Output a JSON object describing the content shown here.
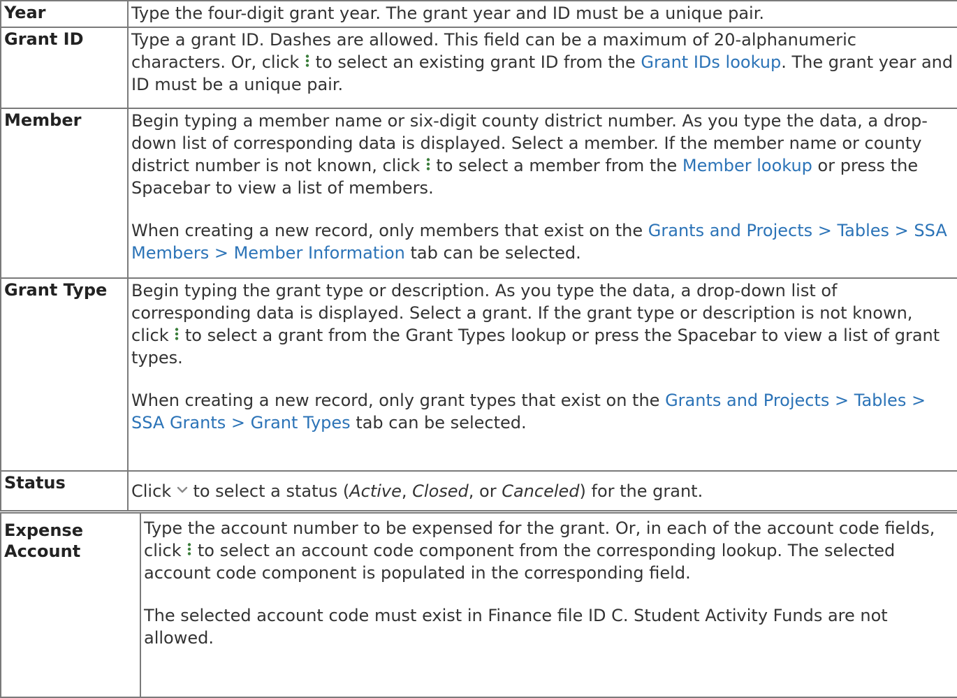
{
  "rows": {
    "year": {
      "label": "Year",
      "text": "Type the four-digit grant year. The grant year and ID must be a unique pair."
    },
    "grant_id": {
      "label": "Grant ID",
      "t1": "Type a grant ID. Dashes are allowed. This field can be a maximum of 20-alphanumeric characters. Or, click ",
      "t2": " to select an existing grant ID from the ",
      "link": "Grant IDs lookup",
      "t3": ". The grant year and ID must be a unique pair."
    },
    "member": {
      "label": "Member",
      "t1": "Begin typing a member name or six-digit county district number. As you type the data, a drop-down list of corresponding data is displayed. Select a member. If the member name or county district number is not known, click ",
      "t2": " to select a member from the ",
      "link": "Member lookup",
      "t3": " or press the Spacebar to view a list of members.",
      "p2_t1": "When creating a new record, only members that exist on the ",
      "p2_link": "Grants and Projects > Tables > SSA Members > Member Information",
      "p2_t2": " tab can be selected."
    },
    "grant_type": {
      "label": "Grant Type",
      "t1": "Begin typing the grant type or description. As you type the data, a drop-down list of corresponding data is displayed. Select a grant. If the grant type or description is not known, click ",
      "t2": " to select a grant from the Grant Types lookup or press the Spacebar to view a list of grant types.",
      "p2_t1": "When creating a new record, only grant types that exist on the ",
      "p2_link": "Grants and Projects > Tables > SSA Grants > Grant Types",
      "p2_t2": " tab can be selected."
    },
    "status": {
      "label": "Status",
      "t1": "Click ",
      "t2": " to select a status (",
      "opt1": "Active",
      "sep1": ", ",
      "opt2": "Closed",
      "sep2": ", or ",
      "opt3": "Canceled",
      "t3": ") for the grant."
    },
    "expense_account": {
      "label_line1": "Expense",
      "label_line2": "Account",
      "t1": "Type the account number to be expensed for the grant. Or, in each of the account code fields, click ",
      "t2": " to select an account code component from the corresponding lookup. The selected account code component is populated in the corresponding field.",
      "p2": "The selected account code must exist in Finance file ID C. Student Activity Funds are not allowed."
    }
  },
  "icons": {
    "lookup": "vertical-ellipsis-icon",
    "dropdown": "chevron-down-icon"
  },
  "colors": {
    "link": "#2b73b7",
    "icon_green": "#3a7d3a",
    "icon_gray": "#888888",
    "border": "#7a7a7a"
  }
}
